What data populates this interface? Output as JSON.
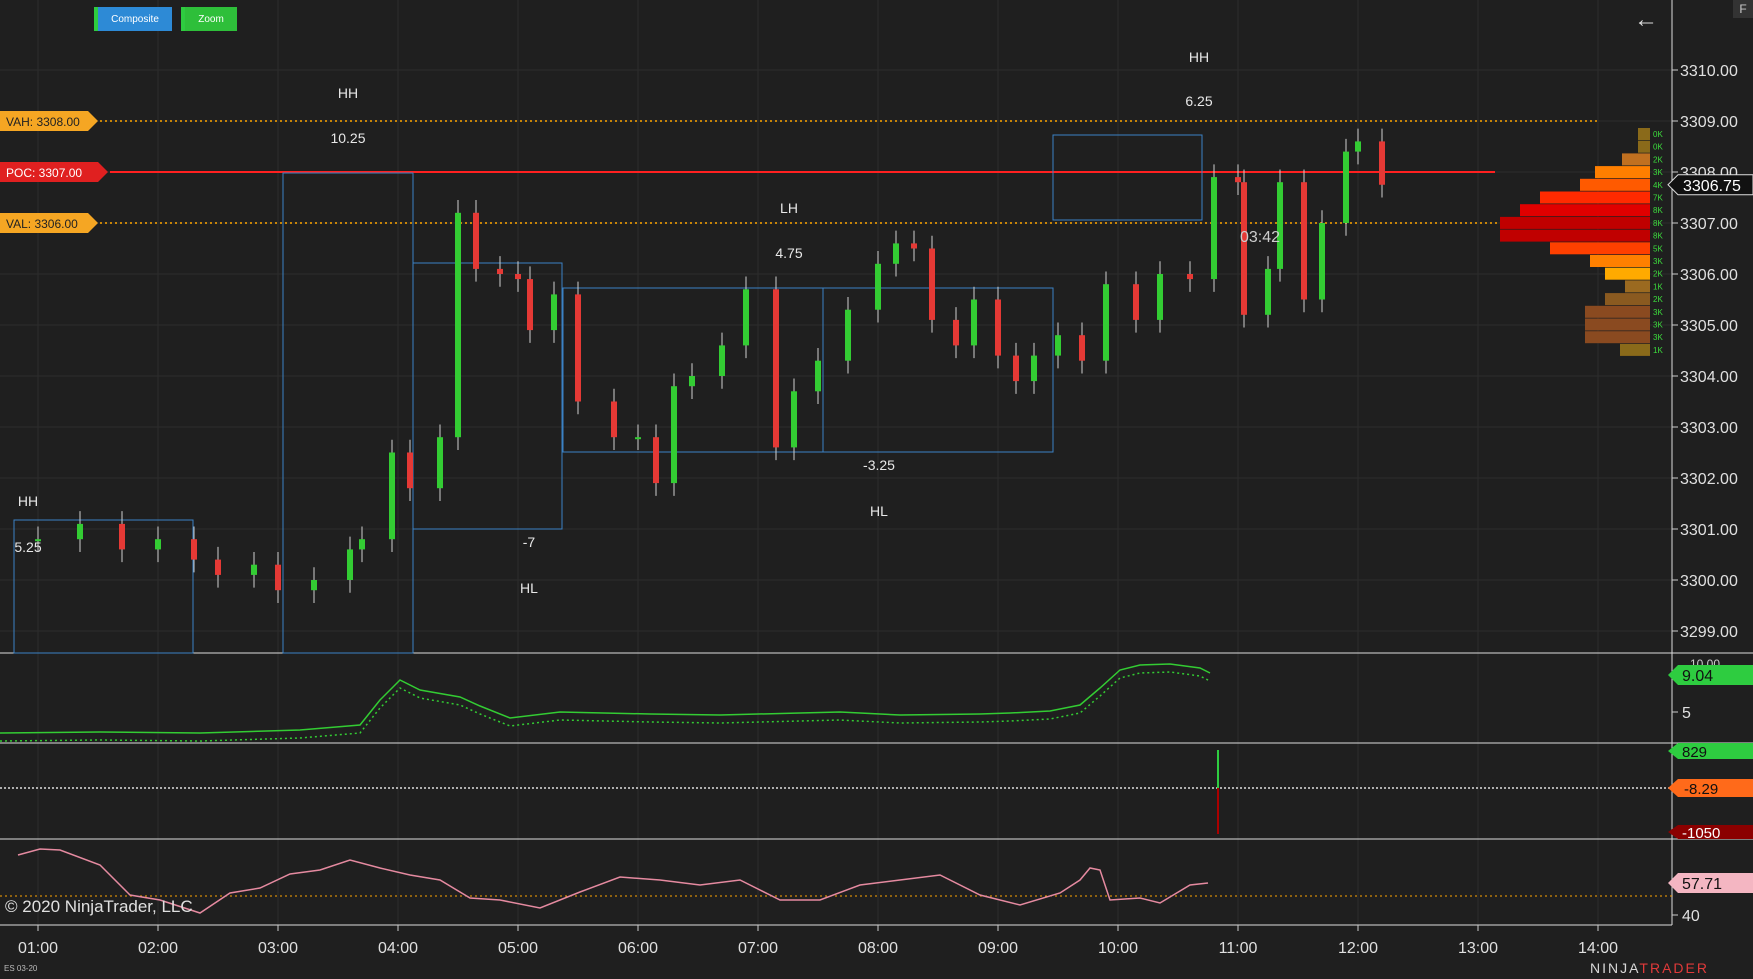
{
  "toolbar": {
    "composite_label": "Composite",
    "zoom_label": "Zoom",
    "back_icon": "arrow-left-icon",
    "f_label": "F"
  },
  "colors": {
    "up": "#33cc33",
    "down": "#e53935",
    "poc": "#ff2020",
    "vah": "#ffa500",
    "box": "#3b82c4",
    "bg": "#1f1f1f"
  },
  "price_axis": {
    "ticks": [
      "3310.00",
      "3309.00",
      "3308.00",
      "3307.00",
      "3306.00",
      "3305.00",
      "3304.00",
      "3303.00",
      "3302.00",
      "3301.00",
      "3300.00",
      "3299.00"
    ],
    "last_price": "3306.75",
    "countdown": "03:42"
  },
  "time_axis": {
    "ticks": [
      "01:00",
      "02:00",
      "03:00",
      "04:00",
      "05:00",
      "06:00",
      "07:00",
      "08:00",
      "09:00",
      "10:00",
      "11:00",
      "12:00",
      "13:00",
      "14:00"
    ]
  },
  "levels": {
    "vah": "VAH: 3308.00",
    "poc": "POC: 3307.00",
    "val": "VAL: 3306.00"
  },
  "swings": [
    {
      "type": "HH",
      "value": "5.25"
    },
    {
      "type": "HH",
      "value": "10.25"
    },
    {
      "type": "HL",
      "value": "-7"
    },
    {
      "type": "LH",
      "value": "4.75"
    },
    {
      "type": "HL",
      "value": "-3.25"
    },
    {
      "type": "HH",
      "value": "6.25"
    }
  ],
  "profile": {
    "labels": [
      "0K",
      "0K",
      "2K",
      "3K",
      "4K",
      "7K",
      "8K",
      "8K",
      "8K",
      "5K",
      "3K",
      "2K",
      "1K",
      "2K",
      "3K",
      "3K",
      "3K",
      "1K"
    ]
  },
  "indicators": {
    "osc1": {
      "value": "9.04",
      "tick": "5",
      "top_label": "10.00"
    },
    "osc2": {
      "top": "829",
      "mid": "-8.29",
      "bottom": "-1050"
    },
    "osc3": {
      "value": "57.71",
      "tick": "40"
    }
  },
  "footer": {
    "copyright": "© 2020 NinjaTrader, LLC",
    "symbol": "ES 03-20",
    "brand_a": "NINJA",
    "brand_b": "TRADER"
  }
}
